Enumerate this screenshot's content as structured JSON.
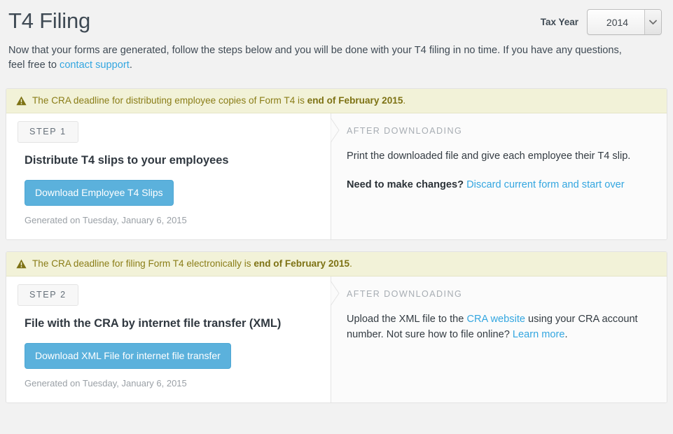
{
  "header": {
    "title": "T4 Filing",
    "tax_year_label": "Tax Year",
    "tax_year_value": "2014",
    "tax_year_options": [
      "2014"
    ],
    "select_arrow_icon": "chevron-down-icon"
  },
  "intro": {
    "text_before": "Now that your forms are generated, follow the steps below and you will be done with your T4 filing in no time. If you have any questions, feel free to ",
    "link_text": "contact support",
    "text_after": "."
  },
  "colors": {
    "accent_button": "#5bb1dc",
    "link": "#33a6e0",
    "notice_background": "#f2f2d8",
    "notice_text": "#8a7d17",
    "page_background": "#f2f2f2",
    "card_background": "#ffffff",
    "right_panel_background": "#fbfbfb"
  },
  "steps": [
    {
      "notice": {
        "icon": "warning-triangle-icon",
        "text_before": "The CRA deadline for distributing employee copies of Form T4 is ",
        "text_bold": "end of February 2015",
        "text_after": "."
      },
      "tab_label": "STEP 1",
      "title": "Distribute T4 slips to your employees",
      "button_label": "Download Employee T4 Slips",
      "generated_text": "Generated on Tuesday, January 6, 2015",
      "right": {
        "heading": "AFTER DOWNLOADING",
        "body_text": "Print the downloaded file and give each employee their T4 slip.",
        "second_bold": "Need to make changes?",
        "second_link": "Discard current form and start over",
        "second_after": ""
      }
    },
    {
      "notice": {
        "icon": "warning-triangle-icon",
        "text_before": "The CRA deadline for filing Form T4 electronically is ",
        "text_bold": "end of February 2015",
        "text_after": "."
      },
      "tab_label": "STEP 2",
      "title": "File with the CRA by internet file transfer (XML)",
      "button_label": "Download XML File for internet file transfer",
      "generated_text": "Generated on Tuesday, January 6, 2015",
      "right": {
        "heading": "AFTER DOWNLOADING",
        "body_before": "Upload the XML file to the ",
        "body_link": "CRA website",
        "body_middle": " using your CRA account number. Not sure how to file online? ",
        "body_link2": "Learn more",
        "body_after": "."
      }
    }
  ]
}
